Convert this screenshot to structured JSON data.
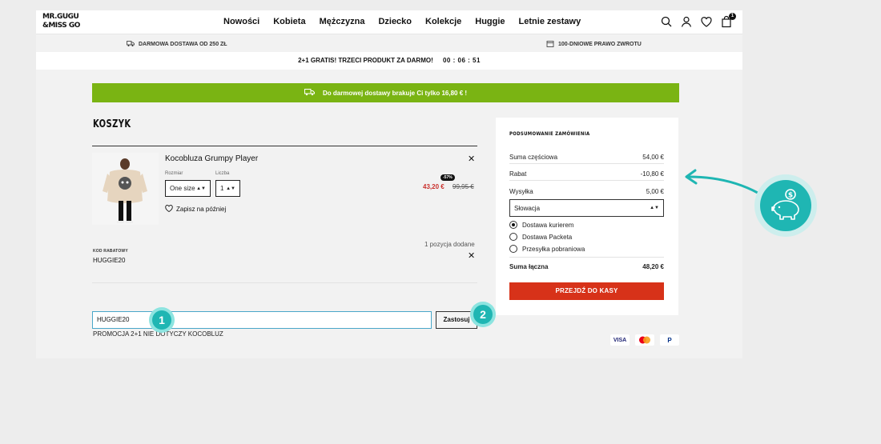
{
  "navbar": {
    "logo_line1": "MR.GUGU",
    "logo_line2": "&MISS GO",
    "links": [
      "Nowości",
      "Kobieta",
      "Mężczyzna",
      "Dziecko",
      "Kolekcje",
      "Huggie",
      "Letnie zestawy"
    ],
    "cart_count": "1"
  },
  "infobar": {
    "free_delivery": "DARMOWA DOSTAWA OD 250 ZŁ",
    "returns": "100-DNIOWE PRAWO ZWROTU"
  },
  "promo": {
    "text": "2+1 GRATIS! TRZECI PRODUKT ZA DARMO!",
    "timer": "00 : 06 : 51"
  },
  "shipping_banner": "Do darmowej dostawy brakuje Ci tylko 16,80 € !",
  "cart": {
    "title": "KOSZYK",
    "item": {
      "name": "Kocobluza Grumpy Player",
      "size_label": "Rozmiar",
      "size_value": "One size",
      "qty_label": "Liczba",
      "qty_value": "1",
      "save_later": "Zapisz na później",
      "discount_badge": "-57%",
      "new_price": "43,20 €",
      "old_price": "99,95 €"
    },
    "positions_added": "1 pozycja dodane",
    "code_label": "KOD RABATOWY",
    "code_value": "HUGGIE20",
    "code_input_value": "HUGGIE20",
    "apply_label": "Zastosuj",
    "promo_note": "PROMOCJA 2+1 NIE DOTYCZY KOCOBLUZ"
  },
  "summary": {
    "title": "PODSUMOWANIE ZAMÓWIENIA",
    "subtotal_label": "Suma częściowa",
    "subtotal_value": "54,00 €",
    "discount_label": "Rabat",
    "discount_value": "-10,80 €",
    "shipping_label": "Wysyłka",
    "shipping_value": "5,00 €",
    "country_value": "Słowacja",
    "delivery_options": [
      "Dostawa kurierem",
      "Dostawa Packeta",
      "Przesyłka pobraniowa"
    ],
    "selected_delivery": "Dostawa kurierem",
    "total_label": "Suma łączna",
    "total_value": "48,20 €",
    "checkout_label": "PRZEJDŹ DO KASY"
  },
  "payments": [
    "VISA",
    "Mastercard",
    "PayPal"
  ],
  "annotations": {
    "step1": "1",
    "step2": "2"
  },
  "colors": {
    "banner_green": "#7ab413",
    "checkout_red": "#d73219",
    "sale_red": "#c9302c",
    "annotation_teal": "#1fb6b3",
    "annotation_light": "#8de4e0"
  }
}
